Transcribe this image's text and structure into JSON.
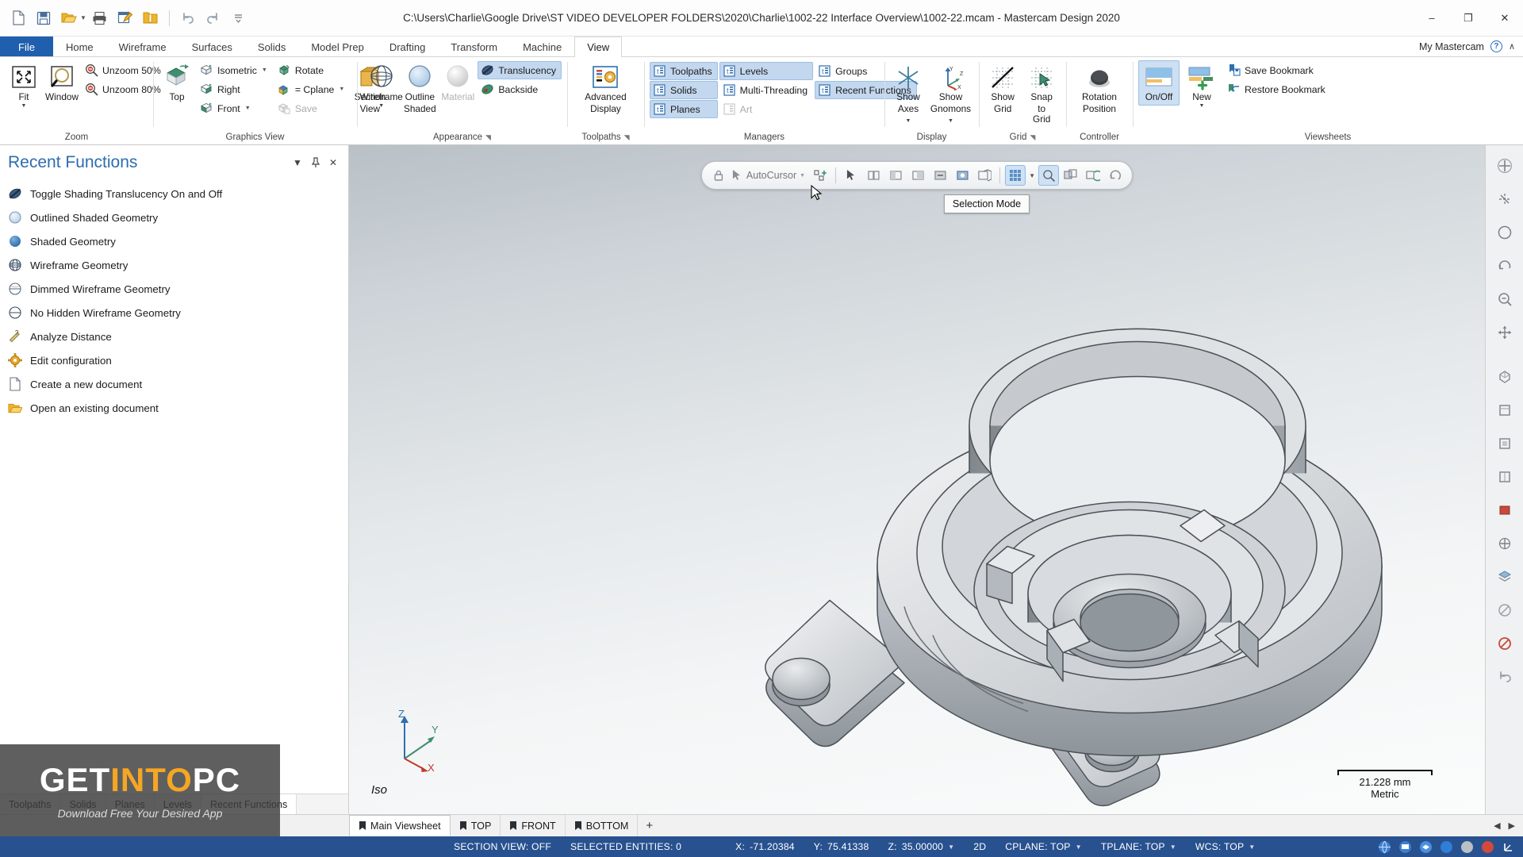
{
  "window": {
    "title": "C:\\Users\\Charlie\\Google Drive\\ST VIDEO DEVELOPER FOLDERS\\2020\\Charlie\\1002-22 Interface Overview\\1002-22.mcam - Mastercam Design 2020",
    "minimize": "–",
    "maximize": "❐",
    "close": "✕"
  },
  "quick_access": [
    {
      "name": "new-document-icon",
      "tip": "New"
    },
    {
      "name": "save-icon",
      "tip": "Save"
    },
    {
      "name": "open-folder-icon",
      "tip": "Open"
    },
    {
      "name": "print-icon",
      "tip": "Print"
    },
    {
      "name": "edit-document-icon",
      "tip": "Edit"
    },
    {
      "name": "zip-folder-icon",
      "tip": "Zip2Go"
    },
    {
      "name": "undo-icon",
      "tip": "Undo"
    },
    {
      "name": "redo-icon",
      "tip": "Redo"
    },
    {
      "name": "customize-qat-icon",
      "tip": "Customize Quick Access Toolbar"
    }
  ],
  "ribbon_tabs": [
    {
      "label": "File",
      "type": "file"
    },
    {
      "label": "Home",
      "type": "normal"
    },
    {
      "label": "Wireframe",
      "type": "normal"
    },
    {
      "label": "Surfaces",
      "type": "normal"
    },
    {
      "label": "Solids",
      "type": "normal"
    },
    {
      "label": "Model Prep",
      "type": "normal"
    },
    {
      "label": "Drafting",
      "type": "normal"
    },
    {
      "label": "Transform",
      "type": "normal"
    },
    {
      "label": "Machine",
      "type": "normal"
    },
    {
      "label": "View",
      "type": "active"
    }
  ],
  "account": {
    "label": "My Mastercam",
    "help": "?",
    "collapse": "∧"
  },
  "ribbon_groups": {
    "zoom": {
      "title": "Zoom",
      "fit": "Fit",
      "window": "Window",
      "unzoom50": "Unzoom 50%",
      "unzoom80": "Unzoom 80%"
    },
    "graphics_view": {
      "title": "Graphics View",
      "top": "Top",
      "isometric": "Isometric",
      "right": "Right",
      "front": "Front",
      "rotate": "Rotate",
      "cplane": "= Cplane",
      "save": "Save",
      "section_view_l1": "Section",
      "section_view_l2": "View"
    },
    "appearance": {
      "title": "Appearance",
      "wireframe": "Wireframe",
      "outline_shaded_l1": "Outline",
      "outline_shaded_l2": "Shaded",
      "material": "Material",
      "translucency": "Translucency",
      "backside": "Backside"
    },
    "toolpaths": {
      "title": "Toolpaths",
      "advanced_display_l1": "Advanced",
      "advanced_display_l2": "Display"
    },
    "managers": {
      "title": "Managers",
      "items": [
        {
          "label": "Toolpaths",
          "state": "selected"
        },
        {
          "label": "Levels",
          "state": "selected"
        },
        {
          "label": "Groups",
          "state": "normal"
        },
        {
          "label": "Solids",
          "state": "selected"
        },
        {
          "label": "Multi-Threading",
          "state": "normal"
        },
        {
          "label": "Recent Functions",
          "state": "selected"
        },
        {
          "label": "Planes",
          "state": "selected"
        },
        {
          "label": "Art",
          "state": "disabled"
        }
      ]
    },
    "display": {
      "title": "Display",
      "show_axes_l1": "Show",
      "show_axes_l2": "Axes",
      "show_gnomons_l1": "Show",
      "show_gnomons_l2": "Gnomons"
    },
    "grid": {
      "title": "Grid",
      "show_grid_l1": "Show",
      "show_grid_l2": "Grid",
      "snap_to_grid_l1": "Snap",
      "snap_to_grid_l2": "to Grid"
    },
    "controller": {
      "title": "Controller",
      "rotation_position_l1": "Rotation",
      "rotation_position_l2": "Position"
    },
    "viewsheets": {
      "title": "Viewsheets",
      "onoff": "On/Off",
      "new": "New",
      "save_bookmark": "Save Bookmark",
      "restore_bookmark": "Restore Bookmark"
    }
  },
  "recent_functions_panel": {
    "title": "Recent Functions",
    "items": [
      {
        "label": "Toggle Shading Translucency On and Off",
        "icon": "translucency-icon"
      },
      {
        "label": "Outlined Shaded Geometry",
        "icon": "outlined-shaded-sphere-icon"
      },
      {
        "label": "Shaded Geometry",
        "icon": "shaded-sphere-icon"
      },
      {
        "label": "Wireframe Geometry",
        "icon": "wireframe-sphere-icon"
      },
      {
        "label": "Dimmed Wireframe Geometry",
        "icon": "dimmed-wireframe-sphere-icon"
      },
      {
        "label": "No Hidden Wireframe Geometry",
        "icon": "no-hidden-wireframe-sphere-icon"
      },
      {
        "label": "Analyze Distance",
        "icon": "ruler-icon"
      },
      {
        "label": "Edit configuration",
        "icon": "gear-icon"
      },
      {
        "label": "Create a new document",
        "icon": "new-document-icon"
      },
      {
        "label": "Open an existing document",
        "icon": "open-folder-icon"
      }
    ],
    "header_buttons": {
      "dropdown": "▼",
      "pin": "pin",
      "close": "✕"
    },
    "tabs": [
      {
        "label": "Toolpaths",
        "active": false
      },
      {
        "label": "Solids",
        "active": false
      },
      {
        "label": "Planes",
        "active": false
      },
      {
        "label": "Levels",
        "active": false
      },
      {
        "label": "Recent Functions",
        "active": true
      }
    ]
  },
  "selection_toolbar": {
    "autocursor_label": "AutoCursor",
    "tooltip": "Selection Mode",
    "buttons": [
      {
        "name": "lock-icon",
        "state": "normal"
      },
      {
        "name": "autocursor-icon",
        "state": "normal"
      },
      {
        "name": "autocursor-dropdown-icon",
        "state": "normal"
      },
      {
        "name": "select-point-icon",
        "state": "normal"
      },
      {
        "name": "select-entity-icon",
        "state": "normal"
      },
      {
        "name": "arrow-select-icon",
        "state": "normal"
      },
      {
        "name": "select-chain-icon",
        "state": "normal"
      },
      {
        "name": "select-window-icon",
        "state": "normal"
      },
      {
        "name": "select-polygon-icon",
        "state": "normal"
      },
      {
        "name": "select-area-icon",
        "state": "normal"
      },
      {
        "name": "select-vector-icon",
        "state": "normal"
      },
      {
        "name": "select-solid-face-icon",
        "state": "normal"
      },
      {
        "name": "selection-mode-grid-icon",
        "state": "on"
      },
      {
        "name": "selection-mode-dropdown-icon",
        "state": "normal"
      },
      {
        "name": "select-all-icon",
        "state": "on"
      },
      {
        "name": "select-only-icon",
        "state": "normal"
      },
      {
        "name": "select-previous-icon",
        "state": "normal"
      },
      {
        "name": "unselect-all-icon",
        "state": "normal"
      }
    ]
  },
  "graphics": {
    "view_label": "Iso",
    "scale_value": "21.228 mm",
    "scale_units": "Metric",
    "gnomon": {
      "x": "X",
      "y": "Y",
      "z": "Z"
    }
  },
  "right_toolbar": [
    {
      "name": "fit-screen-icon"
    },
    {
      "name": "zoom-window-icon"
    },
    {
      "name": "zoom-target-icon"
    },
    {
      "name": "dynamic-rotate-icon"
    },
    {
      "name": "unzoom-icon"
    },
    {
      "name": "pan-icon"
    },
    {
      "name": "isometric-view-icon"
    },
    {
      "name": "top-view-icon"
    },
    {
      "name": "front-view-icon"
    },
    {
      "name": "right-view-icon"
    },
    {
      "name": "shaded-view-icon"
    },
    {
      "name": "wireframe-view-icon"
    },
    {
      "name": "levels-icon"
    },
    {
      "name": "blank-entity-icon"
    },
    {
      "name": "unblank-entity-icon"
    },
    {
      "name": "no-entry-icon"
    },
    {
      "name": "undo-arrow-icon"
    }
  ],
  "viewsheets_bar": {
    "tabs": [
      {
        "label": "Main Viewsheet",
        "active": true
      },
      {
        "label": "TOP",
        "active": false
      },
      {
        "label": "FRONT",
        "active": false
      },
      {
        "label": "BOTTOM",
        "active": false
      }
    ],
    "add": "+",
    "scroll_left": "◀",
    "scroll_right": "▶"
  },
  "status_bar": {
    "section_view": "SECTION VIEW: OFF",
    "selected_entities": "SELECTED ENTITIES: 0",
    "x_label": "X:",
    "x_value": "-71.20384",
    "y_label": "Y:",
    "y_value": "75.41338",
    "z_label": "Z:",
    "z_value": "35.00000",
    "dim_mode": "2D",
    "cplane": "CPLANE: TOP",
    "tplane": "TPLANE: TOP",
    "wcs": "WCS: TOP",
    "icons": [
      {
        "name": "globe-icon",
        "color": "#3b7fd4"
      },
      {
        "name": "display-icon",
        "color": "#3b7fd4"
      },
      {
        "name": "layers-icon",
        "color": "#4a8fe0"
      },
      {
        "name": "sphere-blue-icon",
        "color": "#2f7fd8"
      },
      {
        "name": "sphere-gray-icon",
        "color": "#b9c0c6"
      },
      {
        "name": "sphere-red-icon",
        "color": "#d04a3e"
      },
      {
        "name": "gnomon-icon",
        "color": "#ffffff"
      }
    ]
  },
  "watermark": {
    "get": "GET",
    "into": "INTO",
    "pc": "PC",
    "subtitle": "Download Free Your Desired App"
  },
  "colors": {
    "ribbon_accent": "#1f5fae",
    "status_bar": "#28518f",
    "panel_title": "#2e6cb0",
    "selected_tool": "#cddff2"
  }
}
